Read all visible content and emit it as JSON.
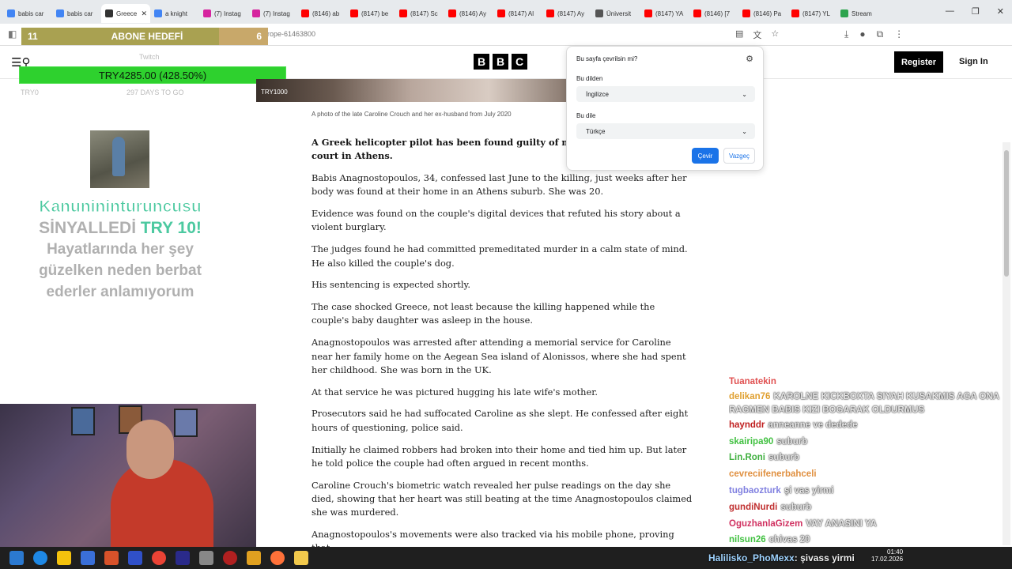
{
  "browser": {
    "tabs": [
      {
        "label": "babis car",
        "color": "#4285f4"
      },
      {
        "label": "babis car",
        "color": "#4285f4"
      },
      {
        "label": "Greece",
        "color": "#333333",
        "active": true
      },
      {
        "label": "a knight",
        "color": "#4285f4"
      },
      {
        "label": "(7) Instag",
        "color": "#d6249f"
      },
      {
        "label": "(7) Instag",
        "color": "#d6249f"
      },
      {
        "label": "(8146) ab",
        "color": "#ff0000"
      },
      {
        "label": "(8147) be",
        "color": "#ff0000"
      },
      {
        "label": "(8147) Sc",
        "color": "#ff0000"
      },
      {
        "label": "(8146) Ay",
        "color": "#ff0000"
      },
      {
        "label": "(8147) Al",
        "color": "#ff0000"
      },
      {
        "label": "(8147) Ay",
        "color": "#ff0000"
      },
      {
        "label": "Üniversit",
        "color": "#555555"
      },
      {
        "label": "(8147) YA",
        "color": "#ff0000"
      },
      {
        "label": "(8146) [7",
        "color": "#ff0000"
      },
      {
        "label": "(8146) Pa",
        "color": "#ff0000"
      },
      {
        "label": "(8147) YL",
        "color": "#ff0000"
      },
      {
        "label": "Stream",
        "color": "#2da44e"
      }
    ],
    "url_fragment": "rope-61463800"
  },
  "overlay": {
    "goal_left": "11",
    "goal_label": "ABONE HEDEFİ",
    "goal_right": "6",
    "goal_fill_fraction": 0.8,
    "donation_text": "TRY4285.00 (428.50%)",
    "tiny_top": "Twitch",
    "tiny_left": "TRY0",
    "tiny_mid": "297 DAYS TO GO",
    "hero_label": "TRY1000",
    "promo_line1": "Kanunininturuncusu",
    "promo_line2a": "SİNYALLEDİ ",
    "promo_line2b": "TRY 10!",
    "promo_line3": "Hayatlarında her şey",
    "promo_line4": "güzelken neden berbat",
    "promo_line5": "ederler anlamıyorum"
  },
  "bbc": {
    "logo": [
      "B",
      "B",
      "C"
    ],
    "register_label": "Register",
    "signin_label": "Sign In",
    "caption": "A photo of the late Caroline Crouch and her ex-husband from July 2020",
    "paragraphs": [
      {
        "text": "A Greek helicopter pilot has been found guilty of murderi… Crouch, by a court in Athens.",
        "lead": true
      },
      {
        "text": "Babis Anagnostopoulos, 34, confessed last June to the killing, just weeks after her body was found at their home in an Athens suburb. She was 20."
      },
      {
        "text": "Evidence was found on the couple's digital devices that refuted his story about a violent burglary."
      },
      {
        "text": "The judges found he had committed premeditated murder in a calm state of mind. He also killed the couple's dog."
      },
      {
        "text": "His sentencing is expected shortly."
      },
      {
        "text": "The case shocked Greece, not least because the killing happened while the couple's baby daughter was asleep in the house."
      },
      {
        "text": "Anagnostopoulos was arrested after attending a memorial service for Caroline near her family home on the Aegean Sea island of Alonissos, where she had spent her childhood. She was born in the UK."
      },
      {
        "text": "At that service he was pictured hugging his late wife's mother."
      },
      {
        "text": "Prosecutors said he had suffocated Caroline as she slept. He confessed after eight hours of questioning, police said."
      },
      {
        "text": "Initially he claimed robbers had broken into their home and tied him up. But later he told police the couple had often argued in recent months."
      },
      {
        "text": "Caroline Crouch's biometric watch revealed her pulse readings on the day she died, showing that her heart was still beating at the time Anagnostopoulos claimed she was murdered."
      },
      {
        "text": "Anagnostopoulos's movements were also tracked via his mobile phone, proving that"
      }
    ]
  },
  "translate": {
    "title": "Bu sayfa çevrilsin mi?",
    "from_label": "Bu dilden",
    "from_value": "İngilizce",
    "to_label": "Bu dile",
    "to_value": "Türkçe",
    "translate_button": "Çevir",
    "cancel_button": "Vazgeç"
  },
  "chat": [
    {
      "user": "Tuanatekin",
      "msg": "",
      "color": "#e05050"
    },
    {
      "user": "delikan76",
      "msg": "KAROLNE KICKBOXTA SIYAH KUSAKMIS AGA ONA RAGMEN BABIS KIZI BOGARAK OLDURMUS",
      "color": "#e0a030"
    },
    {
      "user": "haynddr",
      "msg": "anneanne ve dedede",
      "color": "#c02020"
    },
    {
      "user": "skairipa90",
      "msg": "suburb",
      "color": "#40c040"
    },
    {
      "user": "Lin.Roni",
      "msg": "suburb",
      "color": "#40b040"
    },
    {
      "user": "cevreciifenerbahceli",
      "msg": "",
      "color": "#e09040"
    },
    {
      "user": "tugbaozturk",
      "msg": "şi vas yirmi",
      "color": "#8080e0"
    },
    {
      "user": "gundiNurdi",
      "msg": "suburb",
      "color": "#c03030"
    },
    {
      "user": "OguzhanlaGizem",
      "msg": "VAY ANASINI YA",
      "color": "#d03060"
    },
    {
      "user": "nilsun26",
      "msg": "chivas 20",
      "color": "#40c040"
    }
  ],
  "taskbar": {
    "overlay_user": "Halilisko_PhoMexx",
    "overlay_msg": "şivass yirmi",
    "time": "01:40",
    "date": "17.02.2026"
  }
}
